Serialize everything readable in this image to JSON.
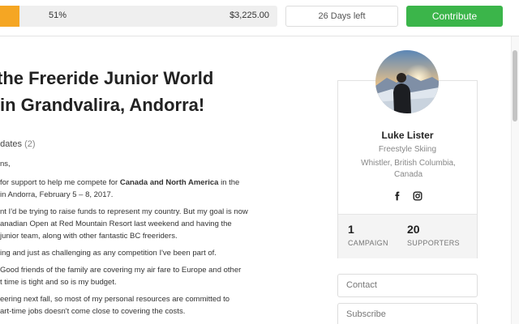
{
  "funding": {
    "percent_label": "51%",
    "percent_value": 51,
    "amount": "$3,225.00",
    "days_left": "26 Days left",
    "contribute_label": "Contribute"
  },
  "article": {
    "title_line1": "the Freeride Junior World",
    "title_line2": "in Grandvalira, Andorra!",
    "updates_label": "pdates",
    "updates_count": "(2)",
    "lines": {
      "l0": "ns,",
      "l1_pre": "for support to help me compete for ",
      "l1_bold": "Canada  and North America",
      "l1_post": " in the",
      "l2": "in Andorra, February 5 – 8, 2017.",
      "l3": "nt I'd be trying to raise funds to represent my country. But my goal is now",
      "l4": "anadian Open at Red Mountain Resort last weekend and having the",
      "l5": "junior team, along with other fantastic BC freeriders.",
      "l6": "ing and just as challenging as any competition I've been part of.",
      "l7": "Good friends of the family are covering my air fare to Europe and other",
      "l8": "t time is tight and so is my budget.",
      "l9": "eering next fall, so most of my personal resources are committed to",
      "l10": "art-time jobs doesn't come close to covering the costs."
    }
  },
  "profile": {
    "name": "Luke Lister",
    "sport": "Freestyle Skiing",
    "location": "Whistler, British Columbia, Canada",
    "campaign_count": "1",
    "campaign_label": "CAMPAIGN",
    "supporters_count": "20",
    "supporters_label": "SUPPORTERS",
    "social_icons": [
      "facebook-icon",
      "instagram-icon"
    ]
  },
  "side_buttons": {
    "contact": "Contact",
    "subscribe": "Subscribe"
  },
  "colors": {
    "progress": "#f5a623",
    "contribute": "#3bb54a"
  }
}
